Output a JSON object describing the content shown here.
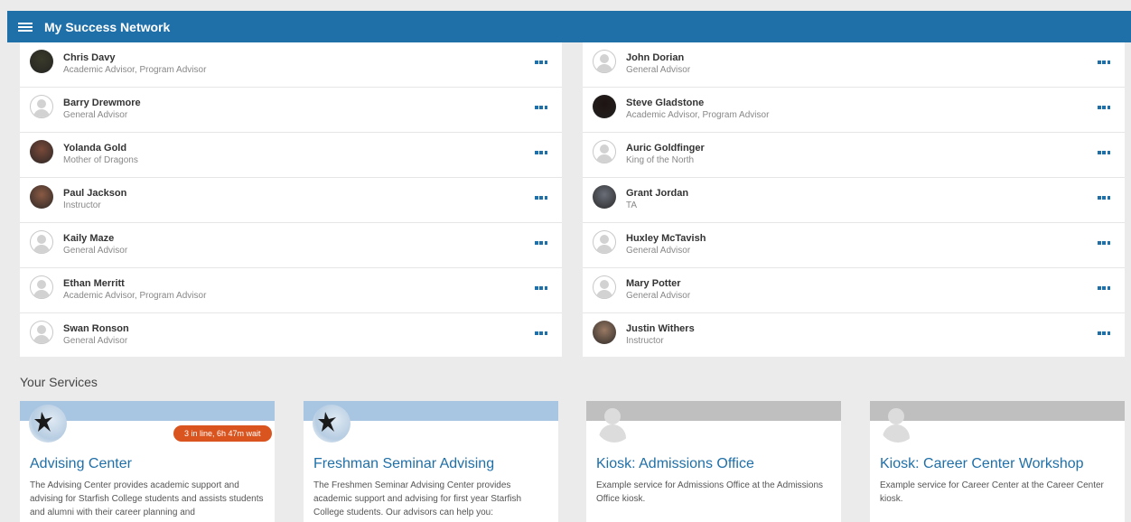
{
  "app": {
    "title": "My Success Network"
  },
  "network": {
    "left": [
      {
        "name": "Chris Davy",
        "role": "Academic Advisor, Program Advisor",
        "avatar": "photo",
        "color": "#3a3a2a"
      },
      {
        "name": "Barry Drewmore",
        "role": "General Advisor",
        "avatar": "default"
      },
      {
        "name": "Yolanda Gold",
        "role": "Mother of Dragons",
        "avatar": "photo",
        "color": "#7a4a3a"
      },
      {
        "name": "Paul Jackson",
        "role": "Instructor",
        "avatar": "photo",
        "color": "#8a5a44"
      },
      {
        "name": "Kaily Maze",
        "role": "General Advisor",
        "avatar": "default"
      },
      {
        "name": "Ethan Merritt",
        "role": "Academic Advisor, Program Advisor",
        "avatar": "default"
      },
      {
        "name": "Swan Ronson",
        "role": "General Advisor",
        "avatar": "default"
      }
    ],
    "right": [
      {
        "name": "John Dorian",
        "role": "General Advisor",
        "avatar": "default"
      },
      {
        "name": "Steve Gladstone",
        "role": "Academic Advisor, Program Advisor",
        "avatar": "photo",
        "color": "#1e1412"
      },
      {
        "name": "Auric Goldfinger",
        "role": "King of the North",
        "avatar": "default"
      },
      {
        "name": "Grant Jordan",
        "role": "TA",
        "avatar": "photo",
        "color": "#6a6e78"
      },
      {
        "name": "Huxley McTavish",
        "role": "General Advisor",
        "avatar": "default"
      },
      {
        "name": "Mary Potter",
        "role": "General Advisor",
        "avatar": "default"
      },
      {
        "name": "Justin Withers",
        "role": "Instructor",
        "avatar": "photo",
        "color": "#9a7a64"
      }
    ]
  },
  "services": {
    "title": "Your Services",
    "cards": [
      {
        "title": "Advising Center",
        "desc": "The Advising Center provides academic support and advising for Starfish College students and assists students and alumni with their career planning and",
        "banner": "blue",
        "logo": "starfish",
        "wait": "3 in line, 6h 47m wait"
      },
      {
        "title": "Freshman Seminar Advising",
        "desc": "The Freshmen Seminar Advising Center provides academic support and advising for first year Starfish College students. Our advisors can help you:",
        "banner": "blue",
        "logo": "starfish",
        "wait": ""
      },
      {
        "title": "Kiosk: Admissions Office",
        "desc": "Example service for Admissions Office at the Admissions Office kiosk.",
        "banner": "gray",
        "logo": "person",
        "wait": ""
      },
      {
        "title": "Kiosk: Career Center Workshop",
        "desc": "Example service for Career Center at the Career Center kiosk.",
        "banner": "gray",
        "logo": "person",
        "wait": ""
      }
    ]
  },
  "colors": {
    "brand": "#1f6fa8",
    "wait_badge": "#d9541e"
  },
  "icons": {
    "menu": "hamburger-icon",
    "more": "ellipsis-icon",
    "default_avatar": "person-icon",
    "service_logo": "starfish-logo"
  }
}
